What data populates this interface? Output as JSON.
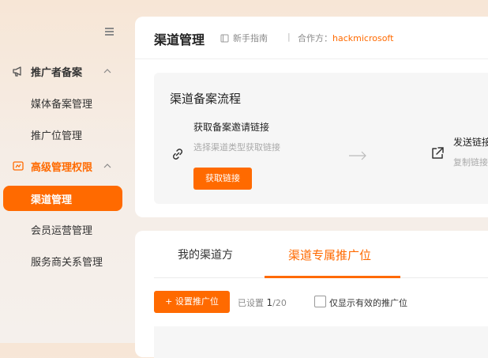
{
  "sidebar": {
    "groups": [
      {
        "label": "推广者备案",
        "icon": "megaphone-icon",
        "active": false,
        "items": [
          "媒体备案管理",
          "推广位管理"
        ]
      },
      {
        "label": "高级管理权限",
        "icon": "permission-icon",
        "active": true,
        "items": [
          "渠道管理",
          "会员运营管理",
          "服务商关系管理"
        ]
      }
    ],
    "selected_item": "渠道管理"
  },
  "header": {
    "title": "渠道管理",
    "guide_label": "新手指南",
    "partner_label": "合作方：",
    "partner_value": "hackmicrosoft"
  },
  "flow": {
    "title": "渠道备案流程",
    "step1": {
      "title": "获取备案邀请链接",
      "desc": "选择渠道类型获取链接",
      "button": "获取链接"
    },
    "step2": {
      "title": "发送链接",
      "desc": "复制链接"
    }
  },
  "tabs": {
    "items": [
      "我的渠道方",
      "渠道专属推广位"
    ],
    "active_index": 1
  },
  "toolbar": {
    "add_button": "+ 设置推广位",
    "count_prefix": "已设置",
    "count_current": "1",
    "count_total": "/20",
    "checkbox_label": "仅显示有效的推广位",
    "checkbox_checked": false
  },
  "colors": {
    "accent": "#ff6a00"
  }
}
